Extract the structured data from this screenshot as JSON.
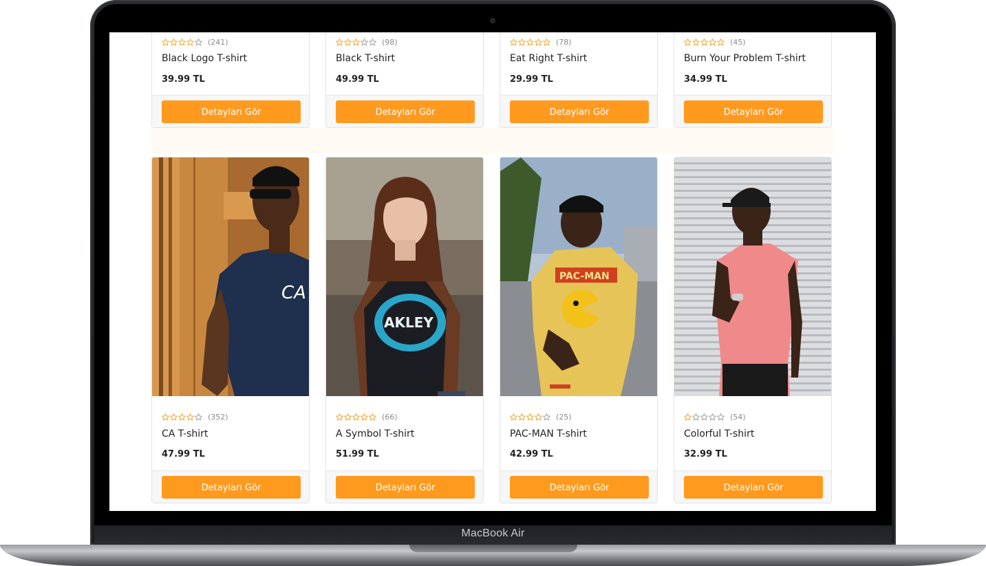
{
  "device": {
    "label": "MacBook Air"
  },
  "colors": {
    "accent": "#ff9a1f",
    "star": "#f0a020",
    "star_empty": "#9a9a9a"
  },
  "top_row": [
    {
      "name": "Black Logo T-shirt",
      "price": "39.99 TL",
      "rating": 4,
      "reviews": "(241)",
      "button": "Detayları Gör"
    },
    {
      "name": "Black T-shirt",
      "price": "49.99 TL",
      "rating": 3,
      "reviews": "(98)",
      "button": "Detayları Gör"
    },
    {
      "name": "Eat Right T-shirt",
      "price": "29.99 TL",
      "rating": 5,
      "reviews": "(78)",
      "button": "Detayları Gör"
    },
    {
      "name": "Burn Your Problem T-shirt",
      "price": "34.99 TL",
      "rating": 5,
      "reviews": "(45)",
      "button": "Detayları Gör"
    }
  ],
  "bottom_row": [
    {
      "name": "CA T-shirt",
      "price": "47.99 TL",
      "rating": 4,
      "reviews": "(352)",
      "button": "Detayları Gör",
      "image": "man-navy-tshirt-photo"
    },
    {
      "name": "A Symbol T-shirt",
      "price": "51.99 TL",
      "rating": 5,
      "reviews": "(66)",
      "button": "Detayları Gör",
      "image": "woman-black-tshirt-photo"
    },
    {
      "name": "PAC-MAN T-shirt",
      "price": "42.99 TL",
      "rating": 4,
      "reviews": "(25)",
      "button": "Detayları Gör",
      "image": "man-yellow-tshirt-photo"
    },
    {
      "name": "Colorful T-shirt",
      "price": "32.99 TL",
      "rating": 1,
      "reviews": "(54)",
      "button": "Detayları Gör",
      "image": "man-pink-tshirt-photo"
    }
  ]
}
